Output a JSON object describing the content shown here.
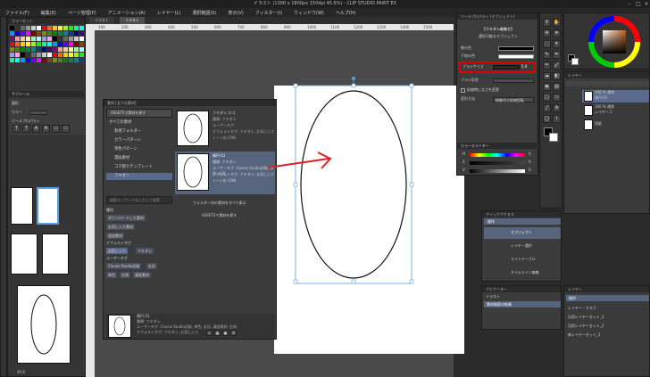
{
  "app": {
    "title": "イラスト (1300 x 1800px 150dpi 45.6%) - CLIP STUDIO PAINT EX",
    "menus": [
      "ファイル(F)",
      "編集(E)",
      "ページ管理(P)",
      "アニメーション(A)",
      "レイヤー(L)",
      "選択範囲(S)",
      "表示(V)",
      "フィルター(I)",
      "ウィンドウ(W)",
      "ヘルプ(H)"
    ]
  },
  "colors": {
    "accent": "#5a6a8c",
    "highlight_box": "#e00000",
    "arrow": "#e02020",
    "selection_line": "#5aa0e0"
  },
  "canvas_tabs": [
    "イラスト",
    "イラスト"
  ],
  "ruler_numbers": [
    "100",
    "200",
    "300",
    "400",
    "500",
    "600",
    "700",
    "800",
    "900",
    "1000",
    "1100",
    "1200",
    "1300",
    "1400",
    "1500"
  ],
  "left": {
    "color_set_title": "カラーセット",
    "sub_tool_title": "サブツール",
    "tool_title": "図形",
    "color_label": "カラー",
    "tool_property_label": "ツールプロパティ",
    "zoom": "45.6"
  },
  "material": {
    "title": "素材 [全ての素材]",
    "assets_btn": "ASSETSで素材を探す",
    "tree": [
      {
        "label": "すべての素材",
        "indent": 0,
        "selected": false
      },
      {
        "label": "新規フォルダー",
        "indent": 1,
        "selected": false
      },
      {
        "label": "カラーパターン",
        "indent": 1,
        "selected": false
      },
      {
        "label": "単色パターン",
        "indent": 1,
        "selected": false
      },
      {
        "label": "漫画素材",
        "indent": 1,
        "selected": false
      },
      {
        "label": "コマ割りテンプレート",
        "indent": 1,
        "selected": false
      },
      {
        "label": "フキダシ",
        "indent": 1,
        "selected": true
      }
    ],
    "search_placeholder": "検索キーワードを入力して検索",
    "type_label": "種別",
    "types": [
      "ダウンロードした素材",
      "お気に入り素材",
      "追加素材"
    ],
    "default_tag_label": "デフォルトタグ",
    "default_tags": [
      "お気に入り",
      "フキダシ"
    ],
    "user_tag_label": "ユーザータグ",
    "user_tags": [
      "Clovez Studio初級",
      "丸形",
      "単色",
      "台詞",
      "漫画素材"
    ],
    "items": [
      {
        "name": "フキダシ ロゴ",
        "lines": [
          "種類: フキダシ",
          "ユーザータグ:",
          "デフォルトタグ: フキダシ, お気に入り",
          "トーン化 (ON)"
        ],
        "selected": false
      },
      {
        "name": "楕円 01",
        "lines": [
          "種類: フキダシ",
          "ユーザータグ: Clovez Studio初級, 単色, 丸形",
          "デフォルトタグ: フキダシ, お気に入り",
          "トーン化 (ON)"
        ],
        "selected": true
      }
    ],
    "folder_empty": "フォルダー内の素材をすべて表示",
    "assets_btn2": "ASSETSで素材を探す",
    "detail": {
      "name": "楕円 01",
      "lines": [
        "種類: フキダシ",
        "ユーザータグ: Clovez Studio初級, 単色, 丸形, 漫画素材, 台詞",
        "デフォルトタグ: フキダシ, お気に入り",
        "トーン化"
      ]
    }
  },
  "tool_prop": {
    "title": "ツールプロパティ [オブジェクト]",
    "name": "【フキダシ編集セ】",
    "sub": "選択可能なオブジェクト",
    "rows": [
      {
        "label": "線の色",
        "value": ""
      },
      {
        "label": "下地の色",
        "value": ""
      },
      {
        "label": "ブラシサイズ",
        "value": "5.0"
      },
      {
        "label": "ブラシ形状",
        "value": ""
      },
      {
        "label": "拡縮時に太さを変更",
        "value": ""
      },
      {
        "label": "変形方法",
        "value": "制御点と拡縮回転"
      }
    ]
  },
  "color_slider": {
    "title": "カラースライダー",
    "rows": [
      {
        "label": "H",
        "value": "0"
      },
      {
        "label": "S",
        "value": "0"
      },
      {
        "label": "V",
        "value": "0"
      }
    ]
  },
  "layers": {
    "title": "レイヤー",
    "items": [
      {
        "name": "100 % 通常",
        "sub": "楕円 01",
        "selected": true
      },
      {
        "name": "100 % 通常",
        "sub": "レイヤー 1",
        "selected": false
      },
      {
        "name": "用紙",
        "sub": "",
        "selected": false
      }
    ]
  },
  "quick": {
    "title": "クイックアクセス",
    "sel_label": "操作",
    "items": [
      "オブジェクト",
      "レイヤー選択",
      "ライトテーブル",
      "タイムライン編集"
    ]
  },
  "nav": {
    "title": "ナビゲーター",
    "rows": [
      "イラスト",
      "素材検索の結果"
    ]
  },
  "layer_list": {
    "title": "レイヤー",
    "header": "操作",
    "items": [
      "レイヤー・マスク",
      "汎用レイヤーセット_1",
      "汎用レイヤーセット_2",
      "新レイヤーセット_1"
    ]
  }
}
